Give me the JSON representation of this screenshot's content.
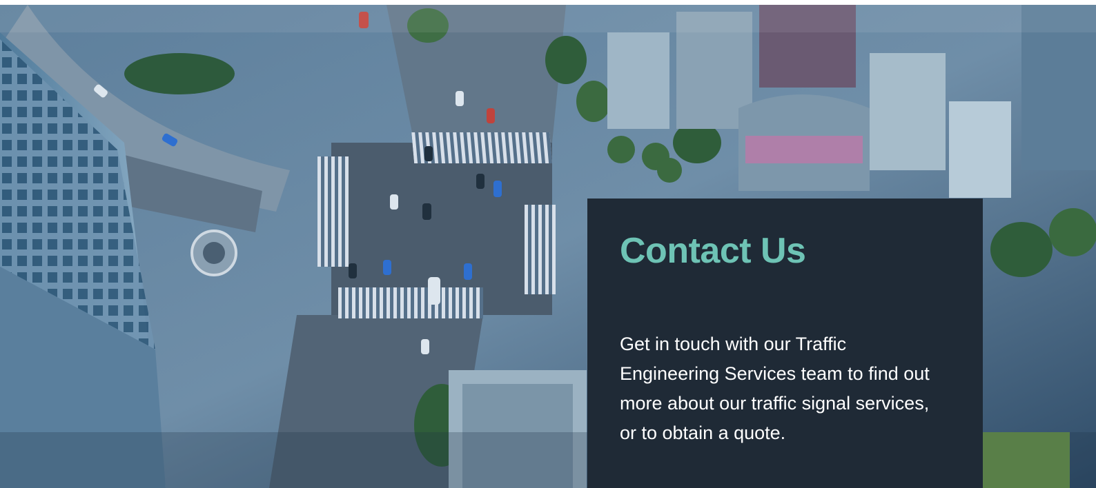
{
  "hero": {
    "image_name": "aerial-city-intersection-photo"
  },
  "contact": {
    "title": "Contact Us",
    "body": "Get in touch with our Traffic Engineering Services team to find out more about our traffic signal services, or to obtain a quote."
  },
  "colors": {
    "card_background": "#1f2a36",
    "title_accent": "#6ec3b5",
    "body_text": "#ffffff"
  }
}
